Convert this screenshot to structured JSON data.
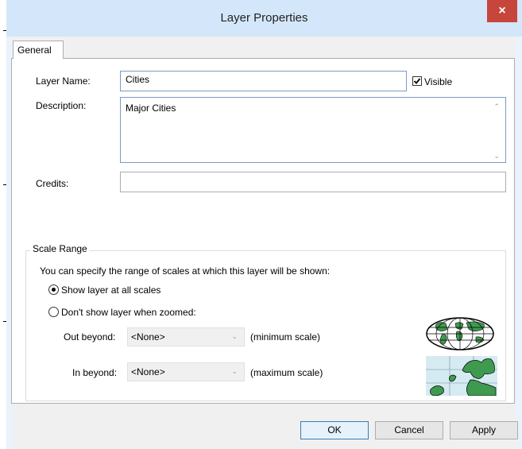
{
  "window": {
    "title": "Layer Properties",
    "close_symbol": "×"
  },
  "tabs": [
    {
      "label": "General",
      "active": true
    }
  ],
  "general": {
    "layer_name_label": "Layer Name:",
    "layer_name_value": "Cities",
    "visible_label": "Visible",
    "visible_checked": true,
    "description_label": "Description:",
    "description_value": "Major Cities",
    "credits_label": "Credits:",
    "credits_value": ""
  },
  "scale_range": {
    "group_title": "Scale Range",
    "intro": "You can specify the range of scales at which this layer will be shown:",
    "options": [
      {
        "label": "Show layer at all scales",
        "selected": true
      },
      {
        "label": "Don't show layer when zoomed:",
        "selected": false
      }
    ],
    "out_beyond_label": "Out beyond:",
    "out_beyond_value": "<None>",
    "out_beyond_hint": "(minimum scale)",
    "in_beyond_label": "In beyond:",
    "in_beyond_value": "<None>",
    "in_beyond_hint": "(maximum scale)"
  },
  "buttons": {
    "ok": "OK",
    "cancel": "Cancel",
    "apply": "Apply"
  },
  "icons": {
    "globe": "globe-icon",
    "map": "europe-map-icon"
  },
  "colors": {
    "title_bar": "#d4e6f9",
    "close_button": "#c7463c",
    "land_green": "#3e9a4f"
  }
}
